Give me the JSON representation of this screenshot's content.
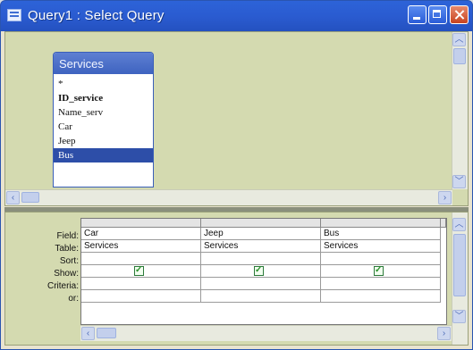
{
  "window": {
    "title": "Query1 : Select Query"
  },
  "field_list": {
    "table_name": "Services",
    "items": [
      "*",
      "ID_service",
      "Name_serv",
      "Car",
      "Jeep",
      "Bus"
    ],
    "selected_index": 5
  },
  "grid": {
    "row_labels": [
      "Field:",
      "Table:",
      "Sort:",
      "Show:",
      "Criteria:",
      "or:"
    ],
    "columns": [
      {
        "field": "Car",
        "table": "Services",
        "sort": "",
        "show": true,
        "criteria": "",
        "or": ""
      },
      {
        "field": "Jeep",
        "table": "Services",
        "sort": "",
        "show": true,
        "criteria": "",
        "or": ""
      },
      {
        "field": "Bus",
        "table": "Services",
        "sort": "",
        "show": true,
        "criteria": "",
        "or": ""
      }
    ]
  },
  "icons": {
    "window": "query-window-icon",
    "minimize": "minimize-icon",
    "maximize": "maximize-icon",
    "close": "close-icon",
    "scroll_up": "chevron-up-icon",
    "scroll_down": "chevron-down-icon",
    "scroll_left": "chevron-left-icon",
    "scroll_right": "chevron-right-icon"
  }
}
